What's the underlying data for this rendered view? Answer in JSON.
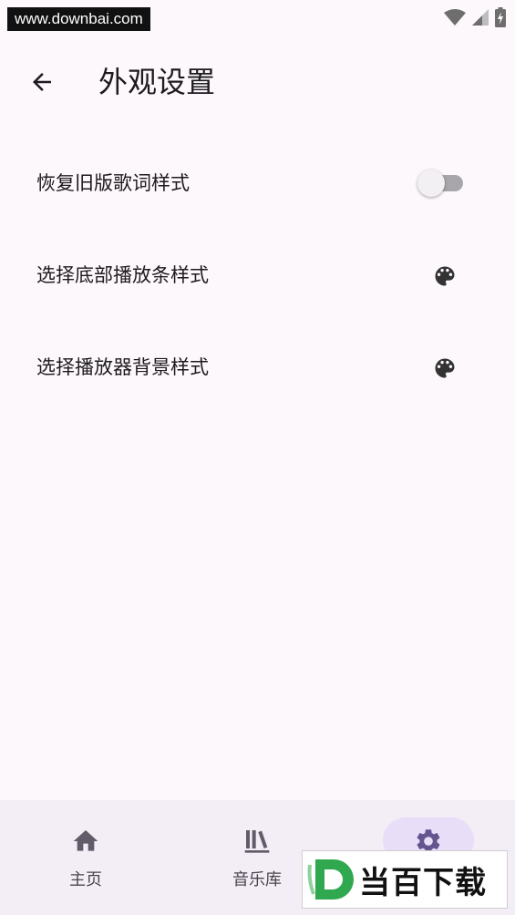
{
  "statusbar": {
    "watermark_url": "www.downbai.com",
    "icons": [
      "wifi-icon",
      "cellular-signal-icon",
      "battery-charging-icon"
    ]
  },
  "appbar": {
    "back_icon": "arrow-back-icon",
    "title": "外观设置"
  },
  "settings": [
    {
      "label": "恢复旧版歌词样式",
      "control": "switch",
      "checked": false
    },
    {
      "label": "选择底部播放条样式",
      "control": "palette-icon"
    },
    {
      "label": "选择播放器背景样式",
      "control": "palette-icon"
    }
  ],
  "bottom_nav": {
    "items": [
      {
        "label": "主页",
        "icon": "home-icon",
        "active": false
      },
      {
        "label": "音乐库",
        "icon": "library-icon",
        "active": false
      },
      {
        "label": "",
        "icon": "settings-gear-icon",
        "active": true
      }
    ]
  },
  "watermark_badge": {
    "text": "当百下载",
    "logo": "d-logo-icon"
  },
  "colors": {
    "background": "#fdf8fc",
    "nav_background": "#f3edf6",
    "active_indicator": "#e8def8",
    "active_icon": "#65558f",
    "text_primary": "#1d1b20",
    "text_secondary": "#49454f",
    "badge_green": "#2fa84f"
  }
}
